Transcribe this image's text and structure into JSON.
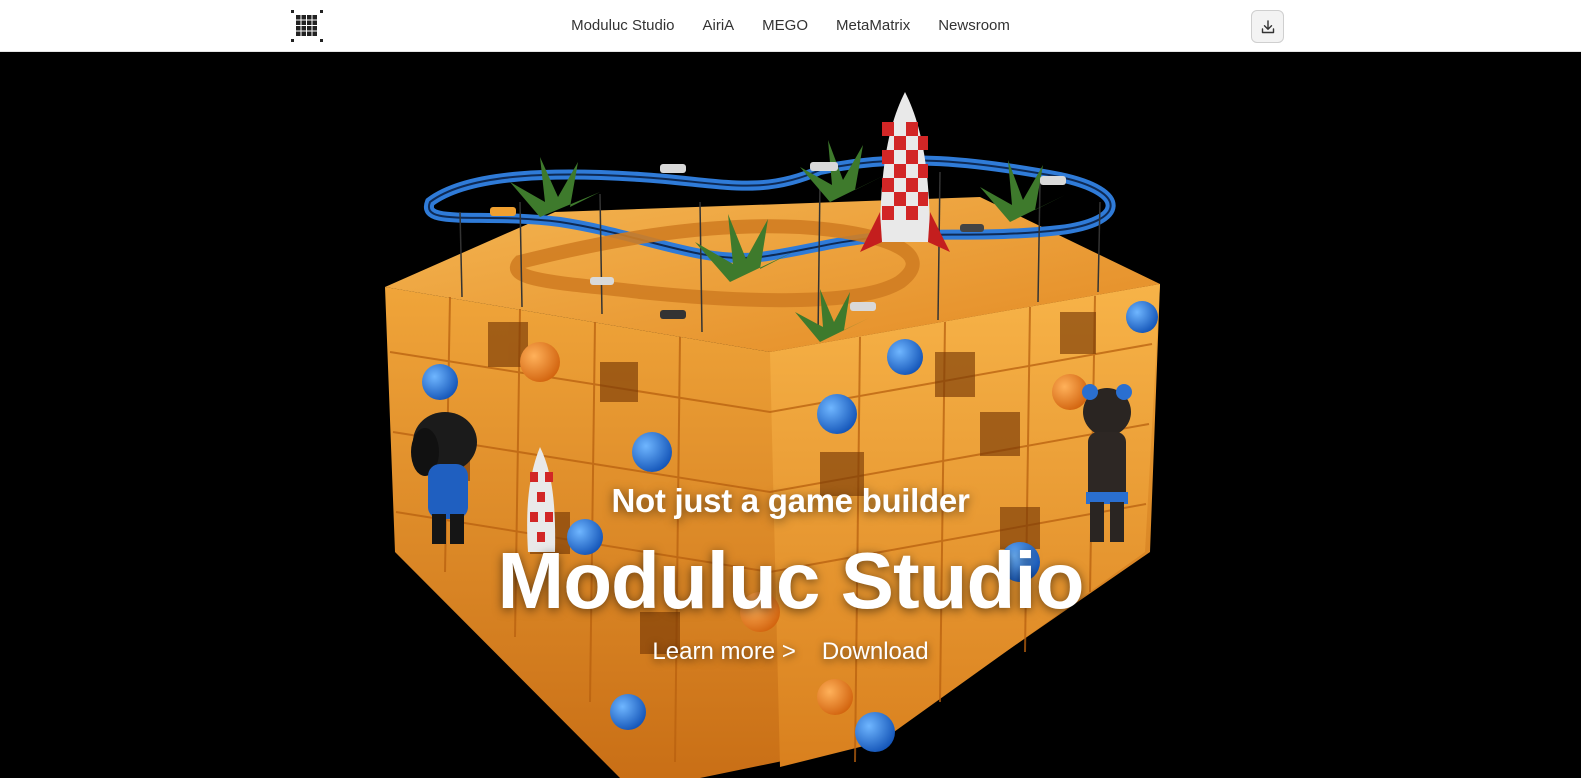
{
  "nav": {
    "logo_icon": "grid-logo-icon",
    "links": [
      "Moduluc Studio",
      "AiriA",
      "MEGO",
      "MetaMatrix",
      "Newsroom"
    ],
    "download_icon": "download-icon"
  },
  "hero": {
    "subtitle": "Not just a game builder",
    "title": "Moduluc Studio",
    "learn_more": "Learn more >",
    "download": "Download",
    "image": "modular-orange-cube-playset-image"
  },
  "colors": {
    "accent_orange": "#f0a23a",
    "track_blue": "#2f7bd8",
    "background": "#000000",
    "navbar": "#ffffff"
  }
}
